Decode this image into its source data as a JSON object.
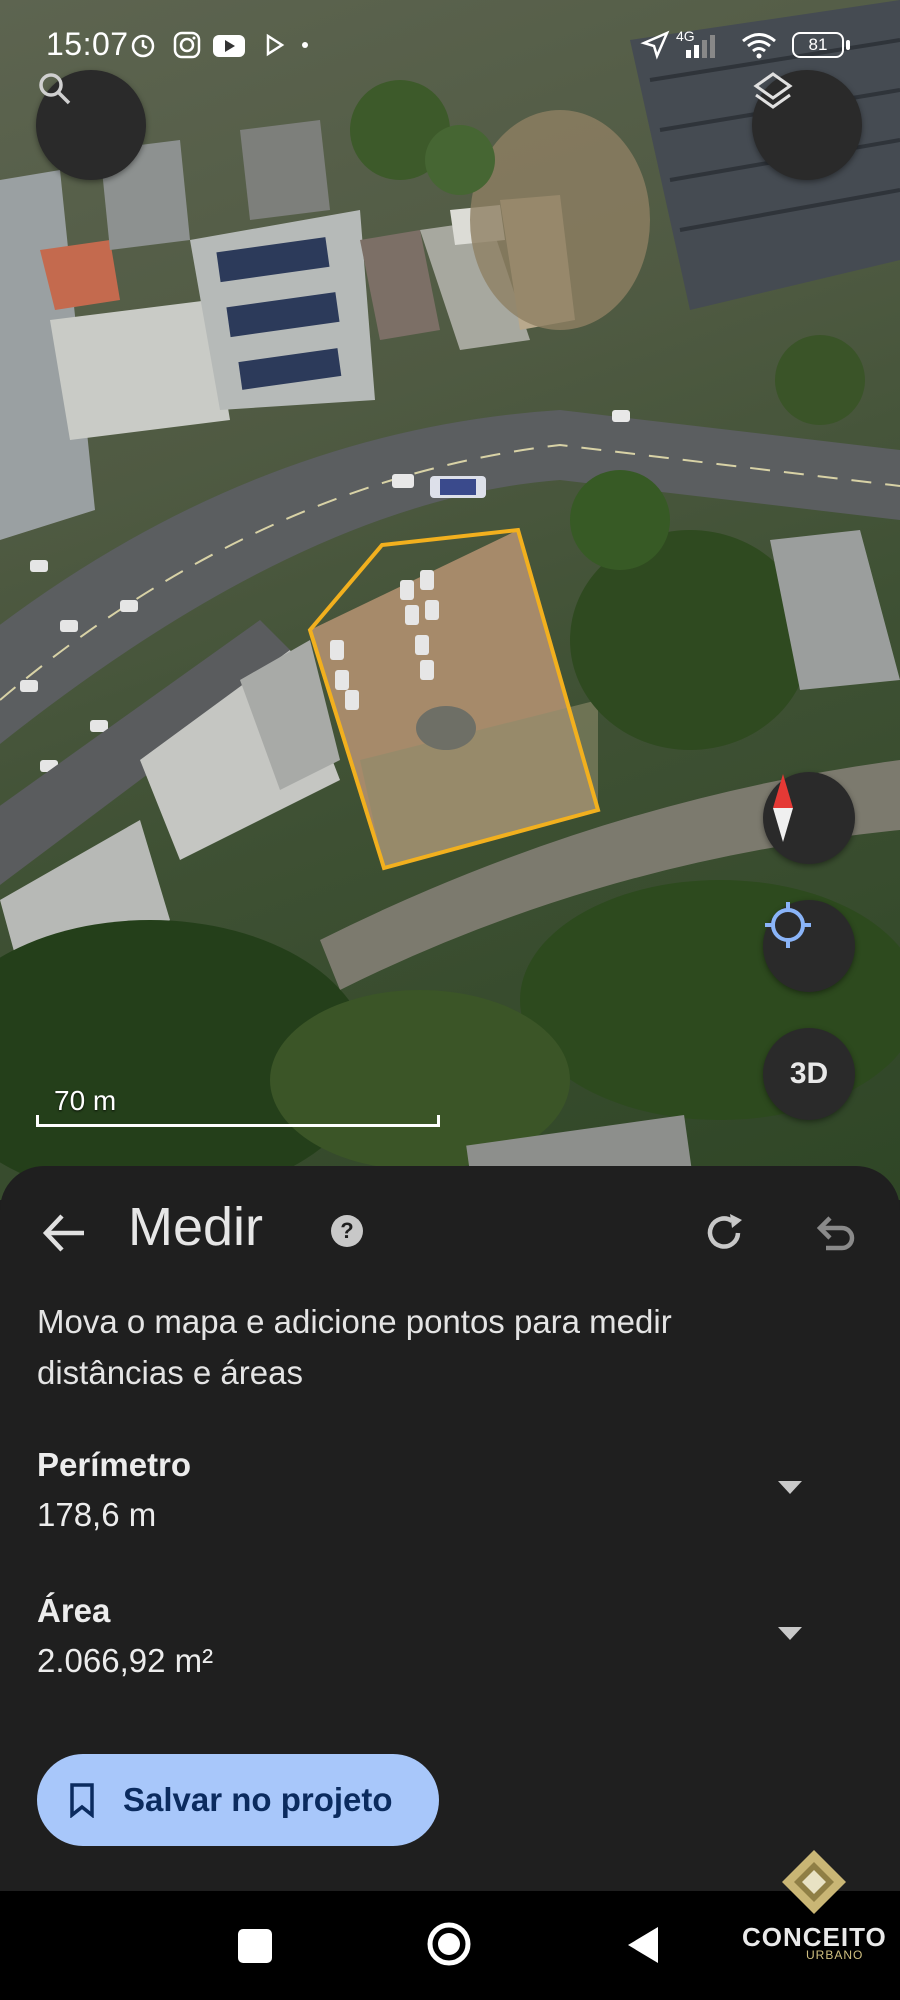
{
  "status_bar": {
    "time": "15:07",
    "network": "4G",
    "battery": "81"
  },
  "map": {
    "scale_label": "70 m",
    "compass_icon": "compass-icon",
    "location_icon": "my-location-icon",
    "btn_3d_label": "3D",
    "polygon_color": "#f2b01e"
  },
  "sheet": {
    "title": "Medir",
    "description": "Mova o mapa e adicione pontos para medir distâncias e áreas",
    "measurements": [
      {
        "label": "Perímetro",
        "value": "178,6 m"
      },
      {
        "label": "Área",
        "value": "2.066,92 m²"
      }
    ],
    "save_label": "Salvar no projeto"
  },
  "watermark": {
    "text": "CONCEITO",
    "sub": "URBANO"
  },
  "colors": {
    "sheet_bg": "#1f1f1f",
    "save_button_bg": "#a8c7fa",
    "save_button_text": "#0b2b5e"
  }
}
